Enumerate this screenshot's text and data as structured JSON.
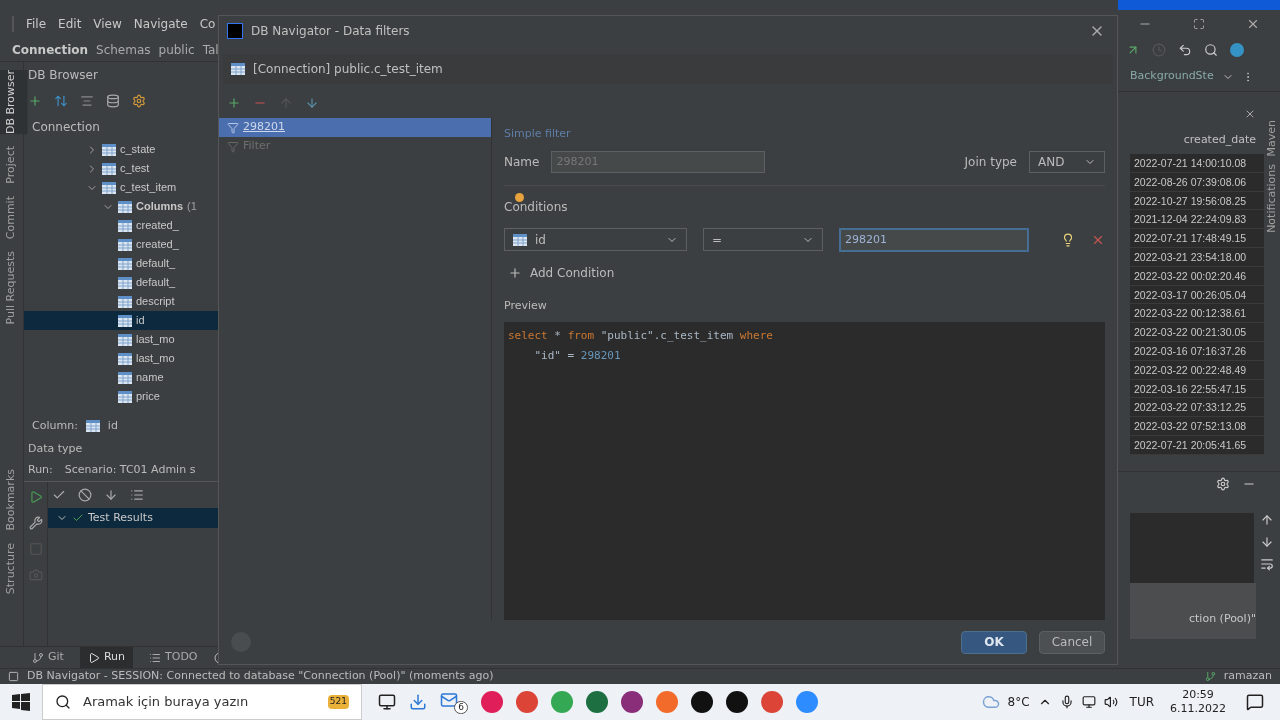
{
  "ide": {
    "menu": [
      "File",
      "Edit",
      "View",
      "Navigate",
      "Co"
    ],
    "breadcrumbs": [
      "Connection",
      "Schemas",
      "public",
      "Tal"
    ],
    "left_strip": [
      {
        "label": "DB Browser",
        "selected": true
      },
      {
        "label": "Project",
        "selected": false
      },
      {
        "label": "Commit",
        "selected": false
      },
      {
        "label": "Pull Requests",
        "selected": false
      }
    ],
    "left_strip_bottom": [
      {
        "label": "Bookmarks"
      },
      {
        "label": "Structure"
      }
    ],
    "db_browser": {
      "title": "DB Browser",
      "root": "Connection",
      "tree": [
        {
          "label": "c_state",
          "expanded": false
        },
        {
          "label": "c_test",
          "expanded": false
        },
        {
          "label": "c_test_item",
          "expanded": true,
          "children": [
            {
              "label": "Columns",
              "count": "(1",
              "expanded": true,
              "children": [
                {
                  "label": "created_",
                  "selected": false
                },
                {
                  "label": "created_",
                  "selected": false
                },
                {
                  "label": "default_",
                  "selected": false
                },
                {
                  "label": "default_",
                  "selected": false
                },
                {
                  "label": "descript",
                  "selected": false
                },
                {
                  "label": "id",
                  "selected": true
                },
                {
                  "label": "last_mo",
                  "selected": false
                },
                {
                  "label": "last_mo",
                  "selected": false
                },
                {
                  "label": "name",
                  "selected": false
                },
                {
                  "label": "price",
                  "selected": false
                }
              ]
            }
          ]
        }
      ]
    },
    "column_info": {
      "label": "Column:",
      "value": "id"
    },
    "data_type": "Data type",
    "run": {
      "label": "Run:",
      "scenario": "Scenario: TC01 Admin s",
      "results": "Test Results",
      "results_selected": true
    },
    "bottom_tabs": [
      {
        "label": "Git",
        "selected": false
      },
      {
        "label": "Run",
        "selected": true
      },
      {
        "label": "TODO",
        "selected": false
      }
    ],
    "right": {
      "branch": "BackgroundSte",
      "column_header": "created_date",
      "dates": [
        "2022-07-21 14:00:10.08",
        "2022-08-26 07:39:08.06",
        "2022-10-27 19:56:08.25",
        "2021-12-04 22:24:09.83",
        "2022-07-21 17:48:49.15",
        "2022-03-21 23:54:18.00",
        "2022-03-22 00:02:20.46",
        "2022-03-17 00:26:05.04",
        "2022-03-22 00:12:38.61",
        "2022-03-22 00:21:30.05",
        "2022-03-16 07:16:37.26",
        "2022-03-22 00:22:48.49",
        "2022-03-16 22:55:47.15",
        "2022-03-22 07:33:12.25",
        "2022-03-22 07:52:13.08",
        "2022-07-21 20:05:41.65"
      ],
      "console_text": "ction (Pool)\"",
      "strip": [
        "Maven",
        "Notifications"
      ]
    }
  },
  "dialog": {
    "title": "DB Navigator - Data filters",
    "context": "[Connection] public.c_test_item",
    "filters": [
      {
        "label": "298201",
        "selected": true
      },
      {
        "label": "Filter",
        "selected": false
      }
    ],
    "section": "Simple filter",
    "name_label": "Name",
    "name_value": "298201",
    "join_label": "Join type",
    "join_value": "AND",
    "conditions_label": "Conditions",
    "condition": {
      "column": "id",
      "operator": "=",
      "value": "298201"
    },
    "add_condition": "Add Condition",
    "preview_label": "Preview",
    "preview": [
      [
        {
          "kind": "keyword",
          "text": "select"
        },
        {
          "kind": "plain",
          "text": " * "
        },
        {
          "kind": "keyword",
          "text": "from"
        },
        {
          "kind": "plain",
          "text": " \"public\".c_test_item "
        },
        {
          "kind": "keyword",
          "text": "where"
        }
      ],
      [
        {
          "kind": "plain",
          "text": "    \"id\" = "
        },
        {
          "kind": "number",
          "text": "298201"
        }
      ]
    ],
    "buttons": [
      {
        "label": "OK",
        "primary": true
      },
      {
        "label": "Cancel",
        "primary": false
      }
    ]
  },
  "status_bar": {
    "message": "DB Navigator  - SESSION: Connected to database \"Connection (Pool)\" (moments ago)",
    "user": "ramazan"
  },
  "taskbar": {
    "search_placeholder": "Aramak için buraya yazın",
    "medal_badge": "521",
    "mail_badge": "6",
    "weather": "8°C",
    "language": "TUR",
    "time": "20:59",
    "date": "6.11.2022"
  }
}
